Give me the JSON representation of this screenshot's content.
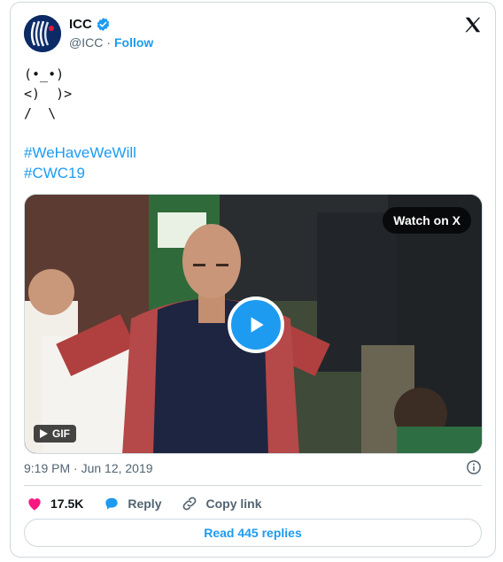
{
  "header": {
    "name": "ICC",
    "handle": "@ICC",
    "separator": "·",
    "follow_label": "Follow"
  },
  "tweet": {
    "kaomoji_lines": [
      "(•_•)",
      "<)  )>",
      "/  \\"
    ],
    "hashtags": [
      "#WeHaveWeWill",
      "#CWC19"
    ]
  },
  "media": {
    "watch_label": "Watch on X",
    "gif_label": "GIF"
  },
  "timestamp": "9:19 PM · Jun 12, 2019",
  "actions": {
    "likes": "17.5K",
    "reply_label": "Reply",
    "copy_label": "Copy link"
  },
  "replies_button": "Read 445 replies",
  "colors": {
    "accent": "#1d9bf0",
    "like": "#f91880",
    "secondary_text": "#536471",
    "border": "#cfd9de"
  }
}
